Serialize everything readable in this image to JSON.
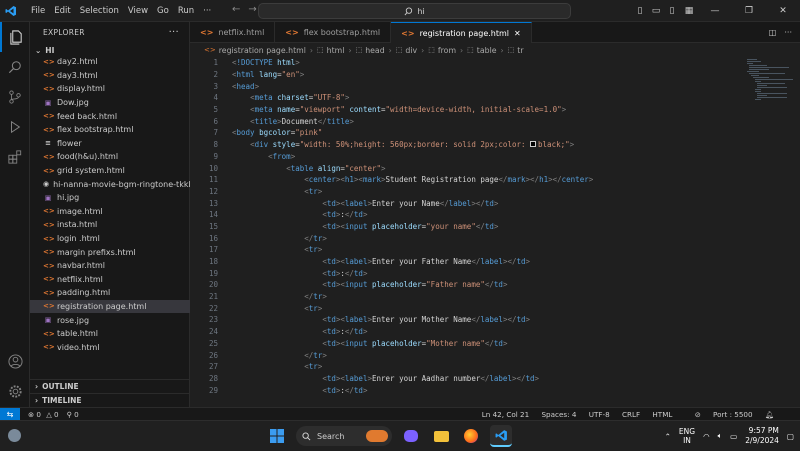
{
  "menu": [
    "File",
    "Edit",
    "Selection",
    "View",
    "Go",
    "Run",
    "···"
  ],
  "command_center": {
    "text": "hi"
  },
  "explorer": {
    "title": "EXPLORER",
    "folder": "HI",
    "files": [
      {
        "name": "day2.html",
        "type": "html"
      },
      {
        "name": "day3.html",
        "type": "html"
      },
      {
        "name": "display.html",
        "type": "html"
      },
      {
        "name": "Dow.jpg",
        "type": "img"
      },
      {
        "name": "feed back.html",
        "type": "html"
      },
      {
        "name": "flex bootstrap.html",
        "type": "html"
      },
      {
        "name": "flower",
        "type": "txt"
      },
      {
        "name": "food(h&u).html",
        "type": "html"
      },
      {
        "name": "grid system.html",
        "type": "html"
      },
      {
        "name": "hi-nanna-movie-bgm-ringtone-tkkb",
        "type": "media"
      },
      {
        "name": "hi.jpg",
        "type": "img"
      },
      {
        "name": "image.html",
        "type": "html"
      },
      {
        "name": "insta.html",
        "type": "html"
      },
      {
        "name": "login .html",
        "type": "html"
      },
      {
        "name": "margin prefixs.html",
        "type": "html"
      },
      {
        "name": "navbar.html",
        "type": "html"
      },
      {
        "name": "netflix.html",
        "type": "html"
      },
      {
        "name": "padding.html",
        "type": "html"
      },
      {
        "name": "registration page.html",
        "type": "html",
        "selected": true
      },
      {
        "name": "rose.jpg",
        "type": "img"
      },
      {
        "name": "table.html",
        "type": "html"
      },
      {
        "name": "video.html",
        "type": "html"
      }
    ],
    "outline": "OUTLINE",
    "timeline": "TIMELINE"
  },
  "tabs": [
    {
      "label": "netflix.html",
      "active": false
    },
    {
      "label": "flex bootstrap.html",
      "active": false
    },
    {
      "label": "registration page.html",
      "active": true
    }
  ],
  "breadcrumb": [
    "registration page.html",
    "html",
    "head",
    "div",
    "from",
    "table",
    "tr"
  ],
  "code_lines": [
    {
      "n": 1,
      "indent": 0,
      "tokens": [
        [
          "t",
          "<"
        ],
        [
          "dt",
          "!DOCTYPE"
        ],
        [
          "at",
          " html"
        ],
        [
          "t",
          ">"
        ]
      ]
    },
    {
      "n": 2,
      "indent": 0,
      "tokens": [
        [
          "t",
          "<"
        ],
        [
          "tg",
          "html"
        ],
        [
          "at",
          " lang"
        ],
        [
          "tx",
          "="
        ],
        [
          "st",
          "\"en\""
        ],
        [
          "t",
          ">"
        ]
      ]
    },
    {
      "n": 3,
      "indent": 0,
      "tokens": [
        [
          "t",
          "<"
        ],
        [
          "tg",
          "head"
        ],
        [
          "t",
          ">"
        ]
      ]
    },
    {
      "n": 4,
      "indent": 2,
      "tokens": [
        [
          "t",
          "<"
        ],
        [
          "tg",
          "meta"
        ],
        [
          "at",
          " charset"
        ],
        [
          "tx",
          "="
        ],
        [
          "st",
          "\"UTF-8\""
        ],
        [
          "t",
          ">"
        ]
      ]
    },
    {
      "n": 5,
      "indent": 2,
      "tokens": [
        [
          "t",
          "<"
        ],
        [
          "tg",
          "meta"
        ],
        [
          "at",
          " name"
        ],
        [
          "tx",
          "="
        ],
        [
          "st",
          "\"viewport\""
        ],
        [
          "at",
          " content"
        ],
        [
          "tx",
          "="
        ],
        [
          "st",
          "\"width=device-width, initial-scale=1.0\""
        ],
        [
          "t",
          ">"
        ]
      ]
    },
    {
      "n": 6,
      "indent": 2,
      "tokens": [
        [
          "t",
          "<"
        ],
        [
          "tg",
          "title"
        ],
        [
          "t",
          ">"
        ],
        [
          "tx",
          "Document"
        ],
        [
          "t",
          "</"
        ],
        [
          "tg",
          "title"
        ],
        [
          "t",
          ">"
        ]
      ]
    },
    {
      "n": 7,
      "indent": 0,
      "tokens": [
        [
          "t",
          "<"
        ],
        [
          "tg",
          "body"
        ],
        [
          "at",
          " bgcolor"
        ],
        [
          "tx",
          "="
        ],
        [
          "st",
          "\"pink\""
        ]
      ]
    },
    {
      "n": 8,
      "indent": 2,
      "tokens": [
        [
          "t",
          "<"
        ],
        [
          "tg",
          "div"
        ],
        [
          "at",
          " style"
        ],
        [
          "tx",
          "="
        ],
        [
          "st",
          "\"width: 50%;height: 560px;border: solid 2px;color: "
        ],
        [
          "sw",
          "■"
        ],
        [
          "st",
          "black;\""
        ],
        [
          "t",
          ">"
        ]
      ]
    },
    {
      "n": 9,
      "indent": 4,
      "tokens": [
        [
          "t",
          "<"
        ],
        [
          "tg",
          "from"
        ],
        [
          "t",
          ">"
        ]
      ]
    },
    {
      "n": 10,
      "indent": 6,
      "tokens": [
        [
          "t",
          "<"
        ],
        [
          "tg",
          "table"
        ],
        [
          "at",
          " align"
        ],
        [
          "tx",
          "="
        ],
        [
          "st",
          "\"center\""
        ],
        [
          "t",
          ">"
        ]
      ]
    },
    {
      "n": 11,
      "indent": 8,
      "tokens": [
        [
          "t",
          "<"
        ],
        [
          "tg",
          "center"
        ],
        [
          "t",
          "><"
        ],
        [
          "tg",
          "h1"
        ],
        [
          "t",
          "><"
        ],
        [
          "tg",
          "mark"
        ],
        [
          "t",
          ">"
        ],
        [
          "tx",
          "Student Registration page"
        ],
        [
          "t",
          "</"
        ],
        [
          "tg",
          "mark"
        ],
        [
          "t",
          "></"
        ],
        [
          "tg",
          "h1"
        ],
        [
          "t",
          "></"
        ],
        [
          "tg",
          "center"
        ],
        [
          "t",
          ">"
        ]
      ]
    },
    {
      "n": 12,
      "indent": 8,
      "tokens": [
        [
          "t",
          "<"
        ],
        [
          "tg",
          "tr"
        ],
        [
          "t",
          ">"
        ]
      ]
    },
    {
      "n": 13,
      "indent": 10,
      "tokens": [
        [
          "t",
          "<"
        ],
        [
          "tg",
          "td"
        ],
        [
          "t",
          "><"
        ],
        [
          "tg",
          "label"
        ],
        [
          "t",
          ">"
        ],
        [
          "tx",
          "Enter your Name"
        ],
        [
          "t",
          "</"
        ],
        [
          "tg",
          "label"
        ],
        [
          "t",
          "></"
        ],
        [
          "tg",
          "td"
        ],
        [
          "t",
          ">"
        ]
      ]
    },
    {
      "n": 14,
      "indent": 10,
      "tokens": [
        [
          "t",
          "<"
        ],
        [
          "tg",
          "td"
        ],
        [
          "t",
          ">"
        ],
        [
          "tx",
          ":"
        ],
        [
          "t",
          "</"
        ],
        [
          "tg",
          "td"
        ],
        [
          "t",
          ">"
        ]
      ]
    },
    {
      "n": 15,
      "indent": 10,
      "tokens": [
        [
          "t",
          "<"
        ],
        [
          "tg",
          "td"
        ],
        [
          "t",
          "><"
        ],
        [
          "tg",
          "input"
        ],
        [
          "at",
          " placeholder"
        ],
        [
          "tx",
          "="
        ],
        [
          "st",
          "\"your name\""
        ],
        [
          "t",
          "</"
        ],
        [
          "tg",
          "td"
        ],
        [
          "t",
          ">"
        ]
      ]
    },
    {
      "n": 16,
      "indent": 8,
      "tokens": [
        [
          "t",
          "</"
        ],
        [
          "tg",
          "tr"
        ],
        [
          "t",
          ">"
        ]
      ]
    },
    {
      "n": 17,
      "indent": 8,
      "tokens": [
        [
          "t",
          "<"
        ],
        [
          "tg",
          "tr"
        ],
        [
          "t",
          ">"
        ]
      ]
    },
    {
      "n": 18,
      "indent": 10,
      "tokens": [
        [
          "t",
          "<"
        ],
        [
          "tg",
          "td"
        ],
        [
          "t",
          "><"
        ],
        [
          "tg",
          "label"
        ],
        [
          "t",
          ">"
        ],
        [
          "tx",
          "Enter your Father Name"
        ],
        [
          "t",
          "</"
        ],
        [
          "tg",
          "label"
        ],
        [
          "t",
          "></"
        ],
        [
          "tg",
          "td"
        ],
        [
          "t",
          ">"
        ]
      ]
    },
    {
      "n": 19,
      "indent": 10,
      "tokens": [
        [
          "t",
          "<"
        ],
        [
          "tg",
          "td"
        ],
        [
          "t",
          ">"
        ],
        [
          "tx",
          ":"
        ],
        [
          "t",
          "</"
        ],
        [
          "tg",
          "td"
        ],
        [
          "t",
          ">"
        ]
      ]
    },
    {
      "n": 20,
      "indent": 10,
      "tokens": [
        [
          "t",
          "<"
        ],
        [
          "tg",
          "td"
        ],
        [
          "t",
          "><"
        ],
        [
          "tg",
          "input"
        ],
        [
          "at",
          " placeholder"
        ],
        [
          "tx",
          "="
        ],
        [
          "st",
          "\"Father name\""
        ],
        [
          "t",
          "</"
        ],
        [
          "tg",
          "td"
        ],
        [
          "t",
          ">"
        ]
      ]
    },
    {
      "n": 21,
      "indent": 8,
      "tokens": [
        [
          "t",
          "</"
        ],
        [
          "tg",
          "tr"
        ],
        [
          "t",
          ">"
        ]
      ]
    },
    {
      "n": 22,
      "indent": 8,
      "tokens": [
        [
          "t",
          "<"
        ],
        [
          "tg",
          "tr"
        ],
        [
          "t",
          ">"
        ]
      ]
    },
    {
      "n": 23,
      "indent": 10,
      "tokens": [
        [
          "t",
          "<"
        ],
        [
          "tg",
          "td"
        ],
        [
          "t",
          "><"
        ],
        [
          "tg",
          "label"
        ],
        [
          "t",
          ">"
        ],
        [
          "tx",
          "Enter your Mother Name"
        ],
        [
          "t",
          "</"
        ],
        [
          "tg",
          "label"
        ],
        [
          "t",
          "></"
        ],
        [
          "tg",
          "td"
        ],
        [
          "t",
          ">"
        ]
      ]
    },
    {
      "n": 24,
      "indent": 10,
      "tokens": [
        [
          "t",
          "<"
        ],
        [
          "tg",
          "td"
        ],
        [
          "t",
          ">"
        ],
        [
          "tx",
          ":"
        ],
        [
          "t",
          "</"
        ],
        [
          "tg",
          "td"
        ],
        [
          "t",
          ">"
        ]
      ]
    },
    {
      "n": 25,
      "indent": 10,
      "tokens": [
        [
          "t",
          "<"
        ],
        [
          "tg",
          "td"
        ],
        [
          "t",
          "><"
        ],
        [
          "tg",
          "input"
        ],
        [
          "at",
          " placeholder"
        ],
        [
          "tx",
          "="
        ],
        [
          "st",
          "\"Mother name\""
        ],
        [
          "t",
          "</"
        ],
        [
          "tg",
          "td"
        ],
        [
          "t",
          ">"
        ]
      ]
    },
    {
      "n": 26,
      "indent": 8,
      "tokens": [
        [
          "t",
          "</"
        ],
        [
          "tg",
          "tr"
        ],
        [
          "t",
          ">"
        ]
      ]
    },
    {
      "n": 27,
      "indent": 8,
      "tokens": [
        [
          "t",
          "<"
        ],
        [
          "tg",
          "tr"
        ],
        [
          "t",
          ">"
        ]
      ]
    },
    {
      "n": 28,
      "indent": 10,
      "tokens": [
        [
          "t",
          "<"
        ],
        [
          "tg",
          "td"
        ],
        [
          "t",
          "><"
        ],
        [
          "tg",
          "label"
        ],
        [
          "t",
          ">"
        ],
        [
          "tx",
          "Enrer your Aadhar number"
        ],
        [
          "t",
          "</"
        ],
        [
          "tg",
          "label"
        ],
        [
          "t",
          "></"
        ],
        [
          "tg",
          "td"
        ],
        [
          "t",
          ">"
        ]
      ]
    },
    {
      "n": 29,
      "indent": 10,
      "tokens": [
        [
          "t",
          "<"
        ],
        [
          "tg",
          "td"
        ],
        [
          "t",
          ">"
        ],
        [
          "tx",
          ":"
        ],
        [
          "t",
          "</"
        ],
        [
          "tg",
          "td"
        ],
        [
          "t",
          ">"
        ]
      ]
    }
  ],
  "status": {
    "errors": "0",
    "warnings": "0",
    "info": "0",
    "position": "Ln 42, Col 21",
    "spaces": "Spaces: 4",
    "encoding": "UTF-8",
    "eol": "CRLF",
    "language": "HTML",
    "port": "Port : 5500"
  },
  "taskbar": {
    "search_placeholder": "Search",
    "lang": "ENG",
    "region": "IN",
    "time": "9:57 PM",
    "date": "2/9/2024"
  },
  "colors": {
    "accent": "#0078d4",
    "html_icon": "#e37933",
    "img_icon": "#a074c4"
  }
}
